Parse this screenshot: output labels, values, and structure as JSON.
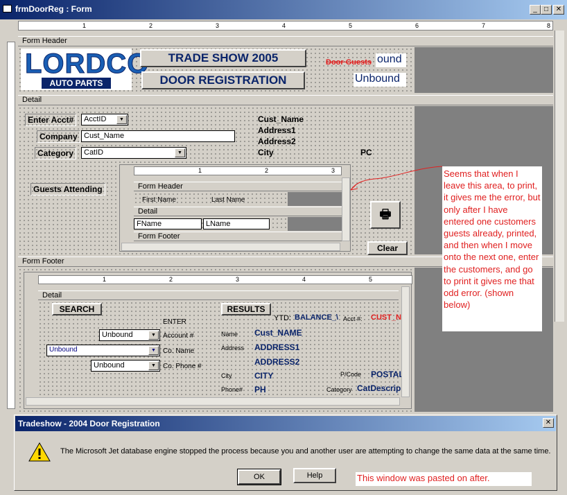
{
  "window": {
    "title": "frmDoorReg : Form",
    "min": "_",
    "max": "□",
    "close": "✕"
  },
  "sections": {
    "form_header": "Form Header",
    "detail": "Detail",
    "form_footer": "Form Footer"
  },
  "logo": {
    "line1": "LORDCO",
    "line2": "AUTO PARTS"
  },
  "header": {
    "title1": "TRADE SHOW 2005",
    "title2": "DOOR REGISTRATION",
    "door_guests_label": "Door Guests",
    "unbound_small": "ound",
    "unbound_big": "Unbound"
  },
  "detail": {
    "acct_label": "Enter Acct#",
    "acct_value": "AcctID",
    "company_label": "Company",
    "company_value": "Cust_Name",
    "category_label": "Category",
    "category_value": "CatID",
    "cust_name": "Cust_Name",
    "address1": "Address1",
    "address2": "Address2",
    "city": "City",
    "pc": "PC",
    "guests_label": "Guests Attending",
    "clear_button": "Clear",
    "print_icon": "printer-icon"
  },
  "subform": {
    "form_header": "Form Header",
    "first_name": "First Name",
    "last_name": "Last Name",
    "detail": "Detail",
    "fname": "FName",
    "lname": "LName",
    "form_footer": "Form Footer",
    "ruler_marks": [
      "1",
      "2",
      "3"
    ]
  },
  "ruler_main": [
    "1",
    "2",
    "3",
    "4",
    "5",
    "6",
    "7",
    "8"
  ],
  "ruler_footer": [
    "1",
    "2",
    "3",
    "4",
    "5"
  ],
  "footer_sub": {
    "detail": "Detail",
    "search_button": "SEARCH",
    "results_button": "RESULTS",
    "enter": "ENTER",
    "unbound1": "Unbound",
    "unbound2": "Unbound",
    "unbound3": "Unbound",
    "account_label": "Account #",
    "coname_label": "Co. Name",
    "cophone_label": "Co. Phone #",
    "ytd_label": "YTD:",
    "balance": "BALANCE_\\",
    "acct_label": "Acct #:",
    "cust_field": "CUST_N",
    "name_label": "Name",
    "cust_name": "Cust_NAME",
    "address_label": "Address",
    "address1": "ADDRESS1",
    "address2": "ADDRESS2",
    "city_label": "City",
    "city": "CITY",
    "pcode_label": "P/Code",
    "postal": "POSTAL",
    "phone_label": "Phone#",
    "phone": "PH",
    "category_label": "Category",
    "catdesc": "CatDescrip"
  },
  "note": {
    "text": "Seems that when I leave this area, to print, it gives me the error, but only after I have entered one customers guests already, printed, and then when I move onto the next one, enter the customers, and go to print it gives me that odd error. (shown below)",
    "color": "#e02020"
  },
  "dialog": {
    "title": "Tradeshow - 2004  Door Registration",
    "close": "✕",
    "message": "The Microsoft Jet database engine stopped the process because you and another user are attempting to change the same data at the same time.",
    "ok": "OK",
    "help": "Help",
    "pasted_note": "This window was pasted on after."
  }
}
